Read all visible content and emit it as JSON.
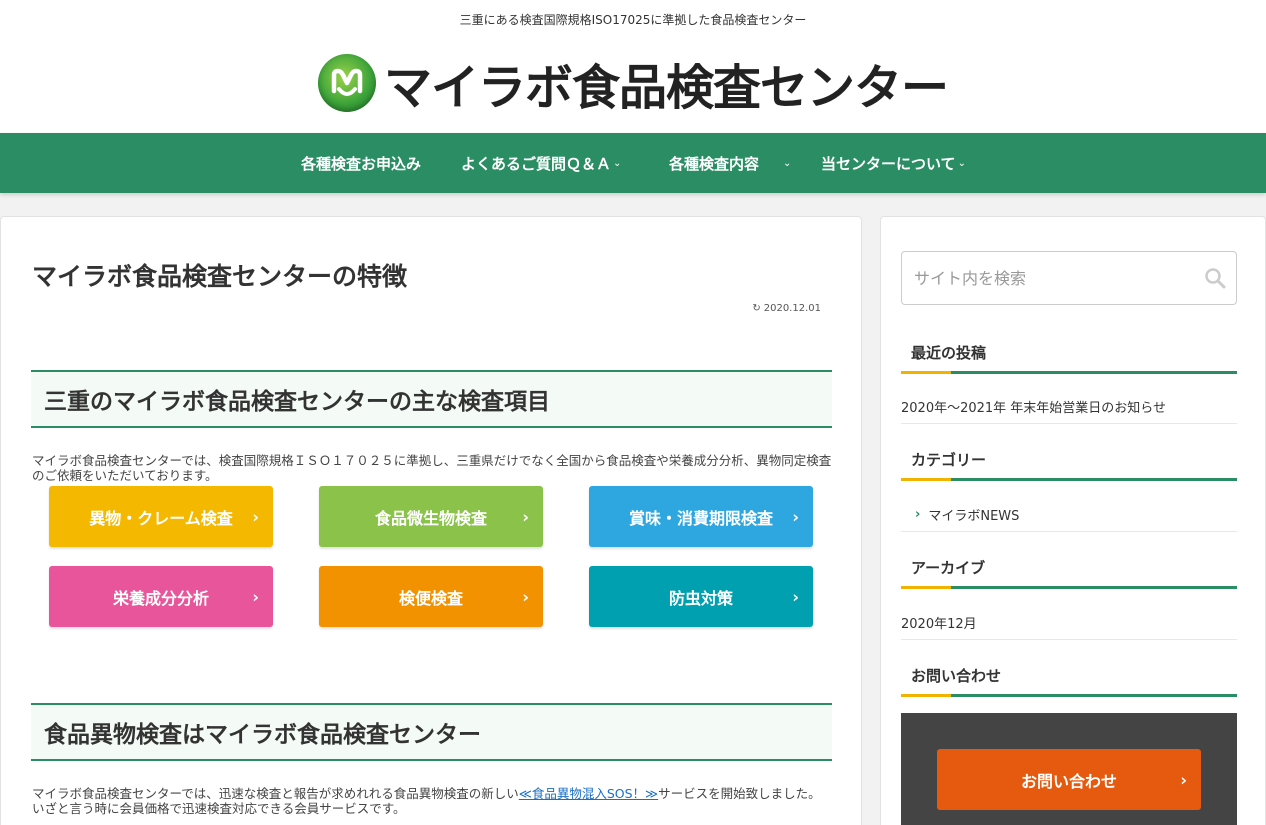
{
  "header": {
    "tagline": "三重にある検査国際規格ISO17025に準拠した食品検査センター",
    "logo_text": "マイラボ食品検査センター"
  },
  "nav": {
    "items": [
      {
        "label": "各種検査お申込み",
        "has_dropdown": false
      },
      {
        "label": "よくあるご質問Ｑ＆Ａ",
        "has_dropdown": true
      },
      {
        "label": "各種検査内容",
        "has_dropdown": true
      },
      {
        "label": "当センターについて",
        "has_dropdown": true
      }
    ],
    "caret": "⌄",
    "bg_color": "#2a8d63"
  },
  "main": {
    "title": "マイラボ食品検査センターの特徴",
    "update_icon": "↻",
    "update_date": "2020.12.01",
    "section1": {
      "heading": "三重のマイラボ食品検査センターの主な検査項目",
      "paragraph": "マイラボ食品検査センターでは、検査国際規格ＩＳＯ１７０２５に準拠し、三重県だけでなく全国から食品検査や栄養成分分析、異物同定検査のご依頼をいただいております。"
    },
    "categories": [
      {
        "label": "異物・クレーム検査",
        "color": "#f5b800"
      },
      {
        "label": "食品微生物検査",
        "color": "#8bc34a"
      },
      {
        "label": "賞味・消費期限検査",
        "color": "#2ea7e0"
      },
      {
        "label": "栄養成分分析",
        "color": "#e8559a"
      },
      {
        "label": "検便検査",
        "color": "#f39200"
      },
      {
        "label": "防虫対策",
        "color": "#00a0b0"
      }
    ],
    "chevron": "›",
    "section2": {
      "heading": "食品異物検査はマイラボ食品検査センター",
      "para_before_link": "マイラボ食品検査センターでは、迅速な検査と報告が求めれれる食品異物検査の新しい",
      "link_text": "≪食品異物混入SOS！≫",
      "para_after_link": "サービスを開始致しました。いざと言う時に会員価格で迅速検査対応できる会員サービスです。"
    }
  },
  "sidebar": {
    "search_placeholder": "サイト内を検索",
    "recent_title": "最近の投稿",
    "recent_items": [
      "2020年～2021年 年末年始営業日のお知らせ"
    ],
    "category_title": "カテゴリー",
    "category_items": [
      "マイラボNEWS"
    ],
    "archive_title": "アーカイブ",
    "archive_items": [
      "2020年12月"
    ],
    "contact_title": "お問い合わせ",
    "contact_button": "お問い合わせ",
    "arrow": "›"
  }
}
